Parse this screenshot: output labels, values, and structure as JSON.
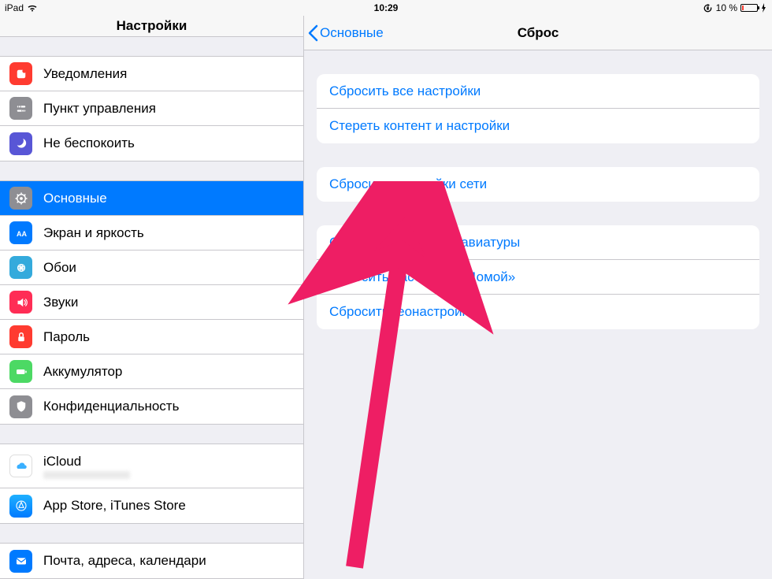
{
  "status": {
    "carrier": "iPad",
    "time": "10:29",
    "battery_pct": "10 %"
  },
  "sidebar": {
    "title": "Настройки",
    "group1": [
      {
        "label": "Уведомления"
      },
      {
        "label": "Пункт управления"
      },
      {
        "label": "Не беспокоить"
      }
    ],
    "group2": [
      {
        "label": "Основные"
      },
      {
        "label": "Экран и яркость"
      },
      {
        "label": "Обои"
      },
      {
        "label": "Звуки"
      },
      {
        "label": "Пароль"
      },
      {
        "label": "Аккумулятор"
      },
      {
        "label": "Конфиденциальность"
      }
    ],
    "group3": [
      {
        "label": "iCloud"
      },
      {
        "label": "App Store, iTunes Store"
      }
    ],
    "group4": [
      {
        "label": "Почта, адреса, календари"
      }
    ]
  },
  "detail": {
    "back_label": "Основные",
    "title": "Сброс",
    "group1": [
      "Сбросить все настройки",
      "Стереть контент и настройки"
    ],
    "group2": [
      "Сбросить настройки сети"
    ],
    "group3": [
      "Сбросить словарь клавиатуры",
      "Сбросить настройки «Домой»",
      "Сбросить геонастройки"
    ]
  }
}
